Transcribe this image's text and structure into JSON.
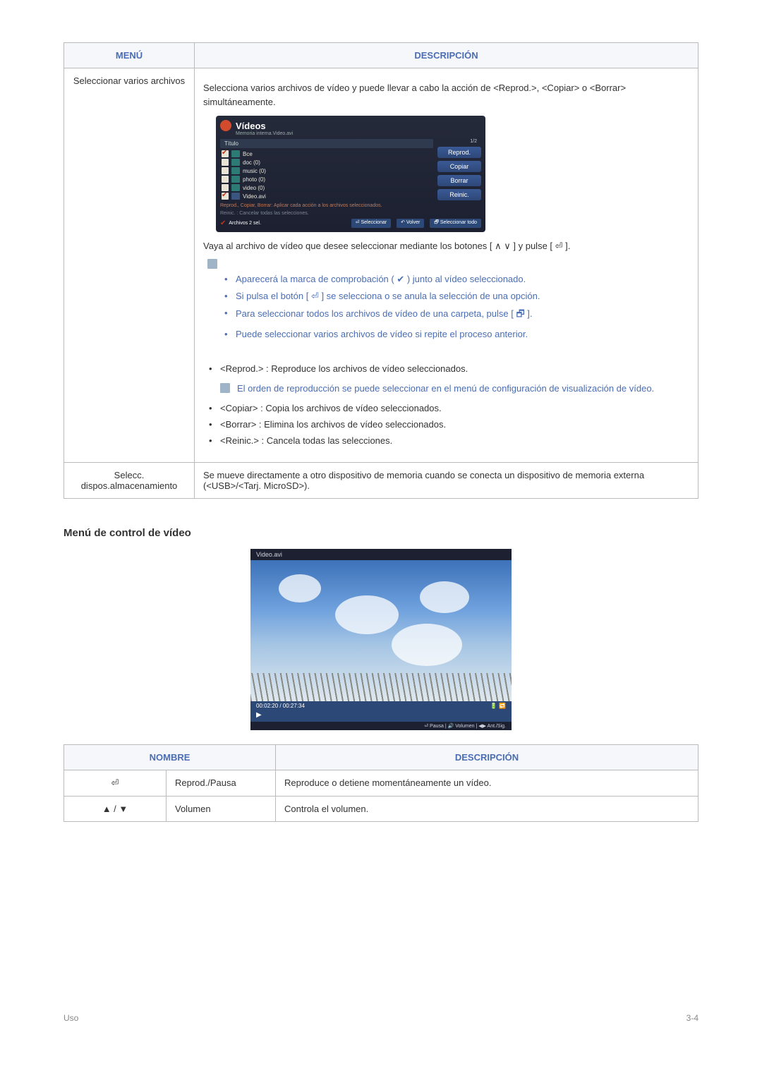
{
  "table1": {
    "head": {
      "menu": "MENÚ",
      "desc": "DESCRIPCIÓN"
    },
    "row1": {
      "label": "Seleccionar varios archivos",
      "intro": "Selecciona varios archivos de vídeo y puede llevar a cabo la acción de <Reprod.>, <Copiar> o <Borrar> simultáneamente.",
      "app": {
        "title": "Vídeos",
        "path": "Memoria interna.Video.avi",
        "list_head": "Título",
        "counter": "1/2",
        "items": [
          {
            "checked": "on",
            "icon": "folder",
            "label": "Bce"
          },
          {
            "checked": "off",
            "icon": "folder",
            "label": "doc (0)"
          },
          {
            "checked": "off",
            "icon": "folder",
            "label": "music (0)"
          },
          {
            "checked": "off",
            "icon": "folder",
            "label": "photo (0)"
          },
          {
            "checked": "off",
            "icon": "folder",
            "label": "video (0)"
          },
          {
            "checked": "on",
            "icon": "movie",
            "label": "Video.avi"
          }
        ],
        "side_buttons": [
          "Reprod.",
          "Copiar",
          "Borrar",
          "Reinic."
        ],
        "hint1": "Reprod., Copiar, Borrar: Aplicar cada acción a los archivos seleccionados.",
        "hint2": "Reinic. : Cancelar todas las selecciones.",
        "foot_left": "Archivos 2 sel.",
        "foot_btns": [
          "⏎ Seleccionar",
          "↶ Volver",
          "🗗 Seleccionar todo"
        ]
      },
      "step": "Vaya al archivo de vídeo que desee seleccionar mediante los botones [ ∧ ∨ ] y pulse [ ⏎ ].",
      "notes": [
        "Aparecerá la marca de comprobación ( ✔ ) junto al vídeo seleccionado.",
        "Si pulsa el botón [ ⏎ ] se selecciona o se anula la selección de una opción.",
        "Para seleccionar todos los archivos de vídeo de una carpeta, pulse [ 🗗 ].",
        "Puede seleccionar varios archivos de vídeo si repite el proceso anterior."
      ],
      "actions": {
        "reprod": "<Reprod.> : Reproduce los archivos de vídeo seleccionados.",
        "reprod_note": "El orden de reproducción se puede seleccionar en el menú de configuración de visualización de vídeo.",
        "copiar": "<Copiar> : Copia los archivos de vídeo seleccionados.",
        "borrar": "<Borrar> : Elimina los archivos de vídeo seleccionados.",
        "reinic": "<Reinic.> : Cancela todas las selecciones."
      }
    },
    "row2": {
      "label": "Selecc. dispos.almacenamiento",
      "desc": "Se mueve directamente a otro dispositivo de memoria cuando se conecta un dispositivo de memoria externa (<USB>/<Tarj. MicroSD>)."
    }
  },
  "section_heading": "Menú de control de vídeo",
  "video": {
    "file": "Video.avi",
    "time": "00:02:20 / 00:27:34",
    "icons": "🔋 🔁",
    "hints": "⏎ Pausa  |  🔊 Volumen  |  ◀▶ Ant./Sig."
  },
  "table2": {
    "head": {
      "name": "NOMBRE",
      "desc": "DESCRIPCIÓN"
    },
    "rows": [
      {
        "icon": "⏎",
        "name": "Reprod./Pausa",
        "desc": "Reproduce o detiene momentáneamente un vídeo."
      },
      {
        "icon": "▲ / ▼",
        "name": "Volumen",
        "desc": "Controla el volumen."
      }
    ]
  },
  "footer": {
    "left": "Uso",
    "right": "3-4"
  }
}
